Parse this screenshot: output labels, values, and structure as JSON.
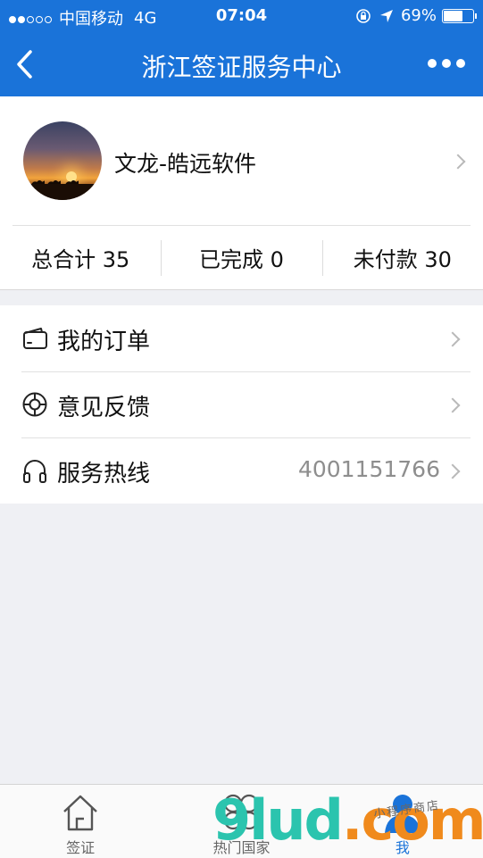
{
  "status_bar": {
    "carrier": "中国移动",
    "network": "4G",
    "time": "07:04",
    "battery": "69%",
    "battery_level": 0.69
  },
  "nav": {
    "title": "浙江签证服务中心",
    "icons": [
      "back-chevron-icon",
      "more-dots-icon"
    ]
  },
  "profile": {
    "name": "文龙-皓远软件"
  },
  "stats": [
    {
      "label": "总合计 35"
    },
    {
      "label": "已完成 0"
    },
    {
      "label": "未付款 30"
    }
  ],
  "menu": [
    {
      "label": "我的订单",
      "icon": "wallet-icon",
      "value": ""
    },
    {
      "label": "意见反馈",
      "icon": "lifebuoy-icon",
      "value": ""
    },
    {
      "label": "服务热线",
      "icon": "headphones-icon",
      "value": "4001151766"
    }
  ],
  "tabs": [
    {
      "label": "签证",
      "icon": "home-icon"
    },
    {
      "label": "热门国家",
      "icon": "grid-icon"
    },
    {
      "label": "我",
      "icon": "user-icon"
    }
  ],
  "watermark": {
    "main_a": "9lud",
    "main_b": ".com",
    "sub": "小程序商店"
  },
  "colors": {
    "primary": "#1a73d9",
    "background": "#eff0f4"
  }
}
